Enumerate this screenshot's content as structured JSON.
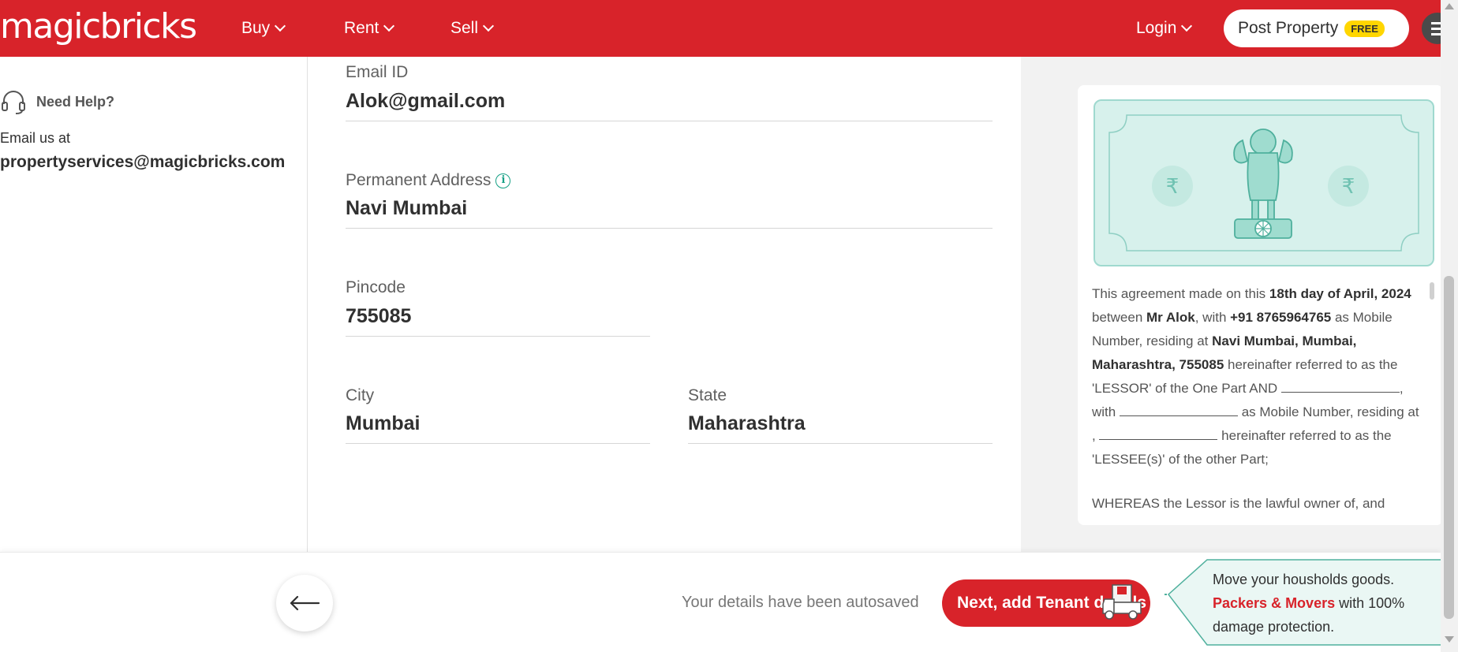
{
  "header": {
    "logo": "magicbricks",
    "nav": [
      {
        "label": "Buy"
      },
      {
        "label": "Rent"
      },
      {
        "label": "Sell"
      }
    ],
    "login_label": "Login",
    "post_property_label": "Post Property",
    "free_badge": "FREE",
    "brand_color": "#d8232a"
  },
  "sidebar": {
    "help_label": "Need Help?",
    "email_us_label": "Email us at",
    "email": "propertyservices@magicbricks.com"
  },
  "form": {
    "email": {
      "label": "Email ID",
      "value": "Alok@gmail.com"
    },
    "address": {
      "label": "Permanent Address",
      "value": "Navi Mumbai",
      "info_icon": "i"
    },
    "pincode": {
      "label": "Pincode",
      "value": "755085"
    },
    "city": {
      "label": "City",
      "value": "Mumbai"
    },
    "state": {
      "label": "State",
      "value": "Maharashtra"
    }
  },
  "agreement": {
    "p1_a": "This agreement made on this ",
    "date": "18th day of April, 2024",
    "p1_b": " between ",
    "lessor": "Mr Alok",
    "p1_c": ", with ",
    "phone": "+91 8765964765",
    "p1_d": " as Mobile Number, residing at ",
    "address": "Navi Mumbai, Mumbai, Maharashtra, 755085",
    "p1_e": " hereinafter referred to as the 'LESSOR' of the One Part AND ",
    "p1_f": ", with ",
    "p1_g": " as Mobile Number, residing at , ",
    "p1_h": " hereinafter referred to as the 'LESSEE(s)' of the other Part;",
    "p2": "WHEREAS the Lessor is the lawful owner of, and",
    "rupee_symbol": "₹"
  },
  "footer": {
    "autosave_text": "Your details have been autosaved",
    "next_label": "Next, add Tenant details",
    "promo_line1": "Move your housholds goods.",
    "promo_highlight": "Packers & Movers",
    "promo_line2": " with 100% damage protection."
  },
  "icons": {
    "back": "arrow-left-icon",
    "help": "headset-icon",
    "truck": "truck-icon",
    "emblem": "emblem-icon",
    "menu": "hamburger-icon"
  }
}
